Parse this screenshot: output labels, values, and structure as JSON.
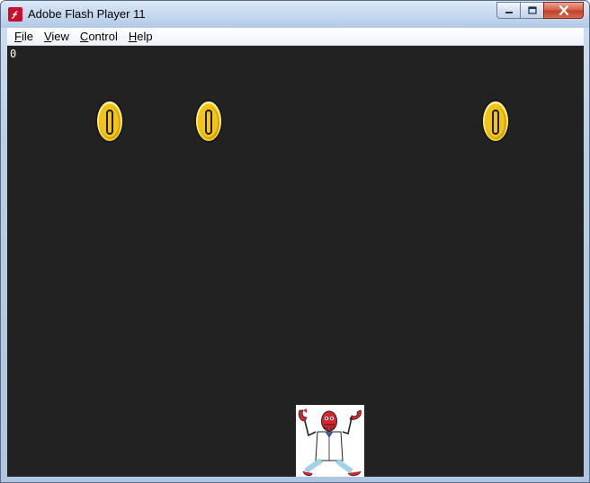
{
  "window": {
    "title": "Adobe Flash Player 11",
    "app_icon": "flash-player-icon",
    "caption_buttons": [
      "minimize-icon",
      "maximize-icon",
      "close-icon"
    ]
  },
  "menu": {
    "items": [
      {
        "label": "File",
        "mnemonic": "F",
        "rest": "ile"
      },
      {
        "label": "View",
        "mnemonic": "V",
        "rest": "iew"
      },
      {
        "label": "Control",
        "mnemonic": "C",
        "rest": "ontrol"
      },
      {
        "label": "Help",
        "mnemonic": "H",
        "rest": "elp"
      }
    ]
  },
  "game": {
    "score": "0",
    "background_color": "#222222",
    "coins": [
      {
        "name": "coin-1",
        "icon": "gold-coin-icon"
      },
      {
        "name": "coin-2",
        "icon": "gold-coin-icon"
      },
      {
        "name": "coin-3",
        "icon": "gold-coin-icon"
      }
    ],
    "player": {
      "icon": "lab-coat-crab-character-icon"
    }
  },
  "colors": {
    "coin_gold": "#f2c416",
    "coin_shadow": "#c88a00",
    "coin_highlight": "#fff3a0",
    "player_skin": "#d8262c",
    "player_coat": "#ffffff",
    "player_pants": "#9fd3e6"
  }
}
